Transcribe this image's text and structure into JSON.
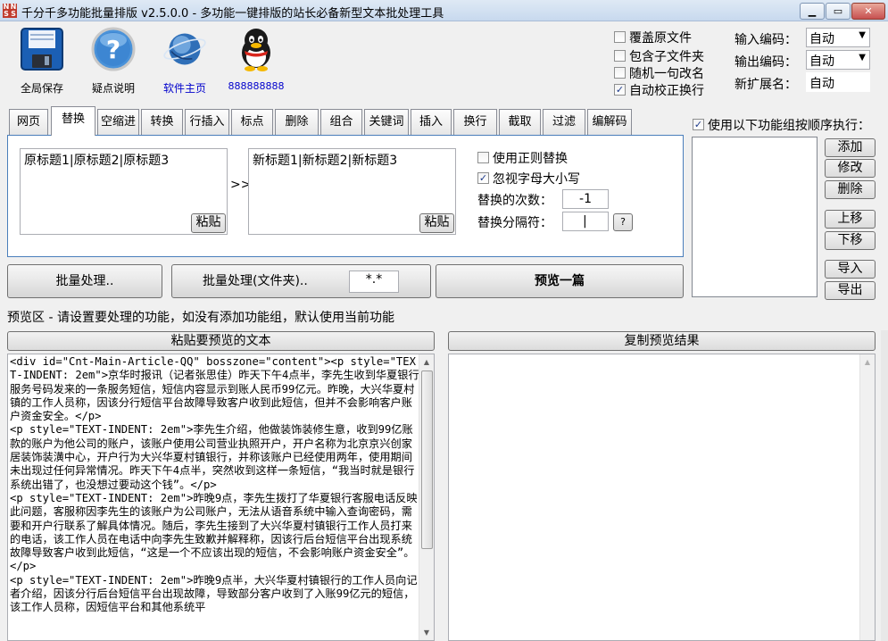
{
  "window": {
    "title": "千分千多功能批量排版 v2.5.0.0 - 多功能一键排版的站长必备新型文本批处理工具",
    "icon_lines": [
      "N",
      "N",
      "S",
      "S"
    ]
  },
  "toolbar": {
    "save_label": "全局保存",
    "help_label": "疑点说明",
    "home_label": "软件主页",
    "qq_label": "888888888"
  },
  "options": {
    "overwrite": {
      "label": "覆盖原文件",
      "checked": false
    },
    "subfolders": {
      "label": "包含子文件夹",
      "checked": false
    },
    "random_name": {
      "label": "随机一句改名",
      "checked": false
    },
    "auto_wrap": {
      "label": "自动校正换行",
      "checked": true,
      "mark": "✓"
    }
  },
  "encoding": {
    "input_label": "输入编码：",
    "input_value": "自动",
    "output_label": "输出编码：",
    "output_value": "自动",
    "ext_label": "新扩展名：",
    "ext_value": "自动",
    "arrow": "▼"
  },
  "tabs": [
    {
      "label": "网页"
    },
    {
      "label": "替换"
    },
    {
      "label": "空缩进"
    },
    {
      "label": "转换"
    },
    {
      "label": "行插入"
    },
    {
      "label": "标点"
    },
    {
      "label": "删除"
    },
    {
      "label": "组合"
    },
    {
      "label": "关键词"
    },
    {
      "label": "插入"
    },
    {
      "label": "换行"
    },
    {
      "label": "截取"
    },
    {
      "label": "过滤"
    },
    {
      "label": "编解码"
    }
  ],
  "active_tab": "替换",
  "replace": {
    "find_text": "原标题1|原标题2|原标题3",
    "replace_text": "新标题1|新标题2|新标题3",
    "arrow_label": ">>",
    "paste_label": "粘贴",
    "regex_label": "使用正则替换",
    "regex_checked": false,
    "ignore_case_label": "忽视字母大小写",
    "ignore_case_checked": true,
    "ignore_case_mark": "✓",
    "count_label": "替换的次数：",
    "count_value": "-1",
    "separator_label": "替换分隔符：",
    "separator_value": "|",
    "help_label": "?"
  },
  "actions": {
    "batch_label": "批量处理..",
    "batch_folder_label": "批量处理(文件夹)..",
    "filter_value": "*.*",
    "preview_label": "预览一篇"
  },
  "groups": {
    "use_label": "使用以下功能组按顺序执行：",
    "use_checked": true,
    "use_mark": "✓",
    "add": "添加",
    "edit": "修改",
    "delete": "删除",
    "up": "上移",
    "down": "下移",
    "import": "导入",
    "export": "导出"
  },
  "preview": {
    "hint": "预览区 - 请设置要处理的功能，如没有添加功能组，默认使用当前功能",
    "paste_button": "粘贴要预览的文本",
    "copy_button": "复制预览结果",
    "source_text": "<div id=\"Cnt-Main-Article-QQ\" bosszone=\"content\"><p style=\"TEXT-INDENT: 2em\">京华时报讯（记者张思佳）昨天下午4点半，李先生收到华夏银行服务号码发来的一条服务短信，短信内容显示到账人民币99亿元。昨晚，大兴华夏村镇的工作人员称，因该分行短信平台故障导致客户收到此短信，但并不会影响客户账户资金安全。</p>\n<p style=\"TEXT-INDENT: 2em\">李先生介绍，他做装饰装修生意，收到99亿账款的账户为他公司的账户，该账户使用公司营业执照开户，开户名称为北京京兴创家居装饰装潢中心，开户行为大兴华夏村镇银行，并称该账户已经使用两年，使用期间未出现过任何异常情况。昨天下午4点半，突然收到这样一条短信，“我当时就是银行系统出错了，也没想过要动这个钱”。</p>\n<p style=\"TEXT-INDENT: 2em\">昨晚9点，李先生拨打了华夏银行客服电话反映此问题，客服称因李先生的该账户为公司账户，无法从语音系统中输入查询密码，需要和开户行联系了解具体情况。随后，李先生接到了大兴华夏村镇银行工作人员打来的电话，该工作人员在电话中向李先生致歉并解释称，因该行后台短信平台出现系统故障导致客户收到此短信，“这是一个不应该出现的短信，不会影响账户资金安全”。</p>\n<p style=\"TEXT-INDENT: 2em\">昨晚9点半，大兴华夏村镇银行的工作人员向记者介绍，因该分行后台短信平台出现故障，导致部分客户收到了入账99亿元的短信，该工作人员称，因短信平台和其他系统平",
    "scroll_up": "▲",
    "scroll_down": "▼"
  },
  "window_buttons": {
    "minimize": "▁",
    "maximize": "▭",
    "close": "✕"
  }
}
